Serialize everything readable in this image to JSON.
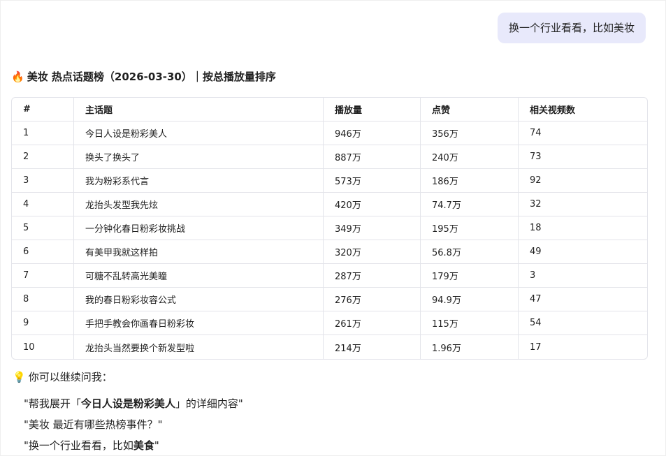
{
  "user_message": "换一个行业看看，比如美妆",
  "title": {
    "icon": "fire-icon",
    "text": "美妆 热点话题榜（2026-03-30）｜按总播放量排序"
  },
  "table": {
    "headers": [
      "#",
      "主话题",
      "播放量",
      "点赞",
      "相关视频数"
    ],
    "rows": [
      [
        "1",
        "今日人设是粉彩美人",
        "946万",
        "356万",
        "74"
      ],
      [
        "2",
        "换头了换头了",
        "887万",
        "240万",
        "73"
      ],
      [
        "3",
        "我为粉彩系代言",
        "573万",
        "186万",
        "92"
      ],
      [
        "4",
        "龙抬头发型我先炫",
        "420万",
        "74.7万",
        "32"
      ],
      [
        "5",
        "一分钟化春日粉彩妆挑战",
        "349万",
        "195万",
        "18"
      ],
      [
        "6",
        "有美甲我就这样拍",
        "320万",
        "56.8万",
        "49"
      ],
      [
        "7",
        "可糖不乱转高光美瞳",
        "287万",
        "179万",
        "3"
      ],
      [
        "8",
        "我的春日粉彩妆容公式",
        "276万",
        "94.9万",
        "47"
      ],
      [
        "9",
        "手把手教会你画春日粉彩妆",
        "261万",
        "115万",
        "54"
      ],
      [
        "10",
        "龙抬头当然要换个新发型啦",
        "214万",
        "1.96万",
        "17"
      ]
    ]
  },
  "tips": {
    "icon": "lightbulb-icon",
    "label": "你可以继续问我：",
    "suggestions": [
      {
        "pre": "\"帮我展开「",
        "bold": "今日人设是粉彩美人",
        "post": "」的详细内容\""
      },
      {
        "pre": "\"美妆 最近有哪些热榜事件？\"",
        "bold": "",
        "post": ""
      },
      {
        "pre": "\"换一个行业看看，比如",
        "bold": "美食",
        "post": "\""
      }
    ]
  }
}
